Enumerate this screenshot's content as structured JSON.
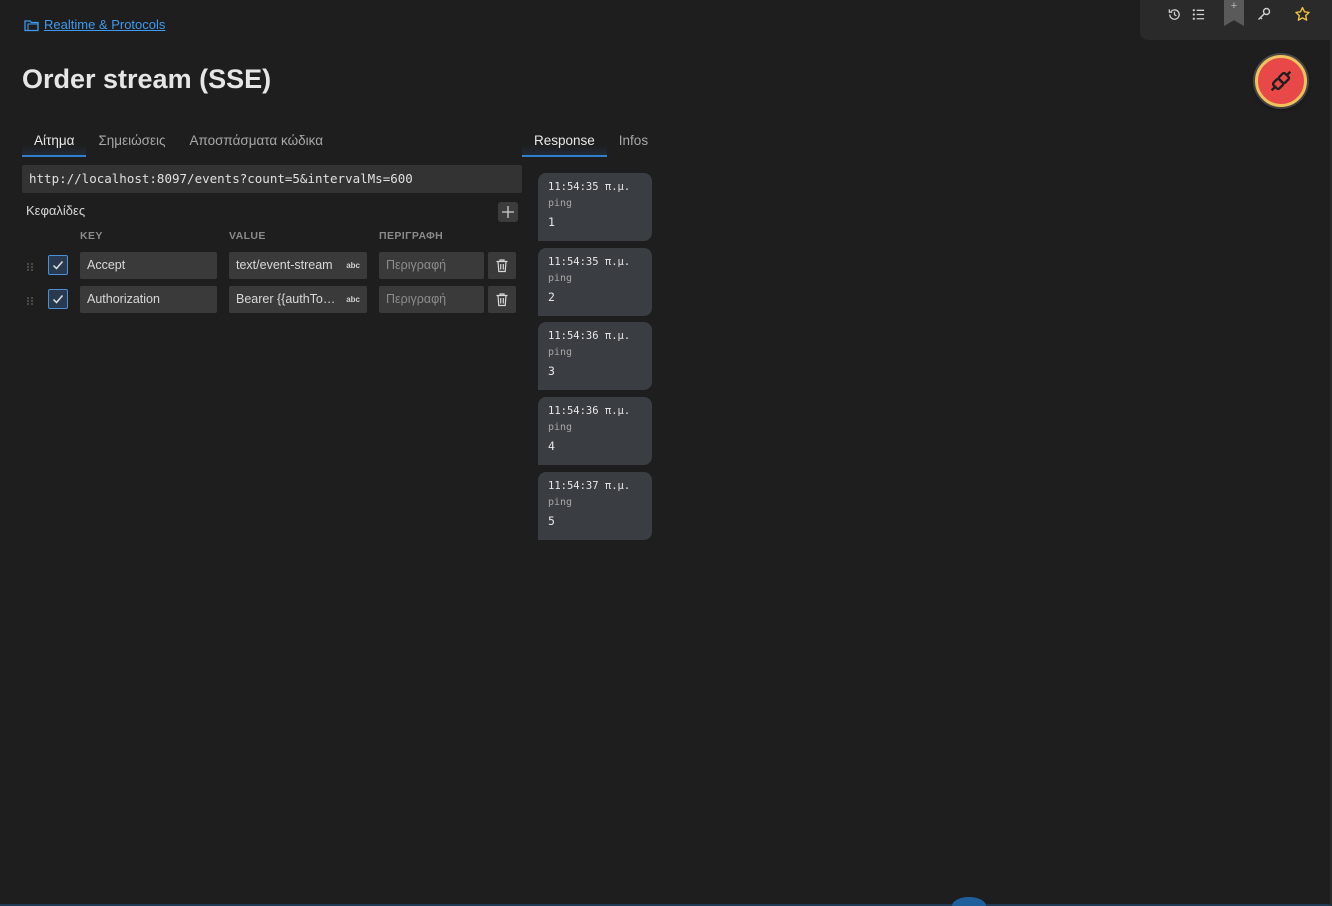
{
  "breadcrumb": {
    "label": "Realtime & Protocols",
    "icon": "folder-icon"
  },
  "title": "Order stream (SSE)",
  "toolbar": {
    "icons": [
      "history-icon",
      "list-icon",
      "bookmark-icon",
      "key-icon",
      "star-icon"
    ],
    "bookmark_glyph": "+"
  },
  "request_tabs": [
    {
      "label": "Αίτημα",
      "active": true
    },
    {
      "label": "Σημειώσεις",
      "active": false
    },
    {
      "label": "Αποσπάσματα κώδικα",
      "active": false
    }
  ],
  "response_tabs": [
    {
      "label": "Response",
      "active": true
    },
    {
      "label": "Infos",
      "active": false
    }
  ],
  "url": "http://localhost:8097/events?count=5&intervalMs=600",
  "headers": {
    "label": "Κεφαλίδες",
    "columns": {
      "key": "KEY",
      "value": "VALUE",
      "description": "ΠΕΡΙΓΡΑΦΗ"
    },
    "rows": [
      {
        "enabled": true,
        "key": "Accept",
        "value": "text/event-stream",
        "value_type": "abc",
        "description_placeholder": "Περιγραφή"
      },
      {
        "enabled": true,
        "key": "Authorization",
        "value": "Bearer {{authToken}}",
        "value_type": "abc",
        "description_placeholder": "Περιγραφή"
      }
    ]
  },
  "events": [
    {
      "time": "11:54:35 π.μ.",
      "type": "ping",
      "data": "1"
    },
    {
      "time": "11:54:35 π.μ.",
      "type": "ping",
      "data": "2"
    },
    {
      "time": "11:54:36 π.μ.",
      "type": "ping",
      "data": "3"
    },
    {
      "time": "11:54:36 π.μ.",
      "type": "ping",
      "data": "4"
    },
    {
      "time": "11:54:37 π.μ.",
      "type": "ping",
      "data": "5"
    }
  ],
  "colors": {
    "accent": "#2f7fd1",
    "link": "#3d9af0",
    "fab": "#e94848",
    "fab_ring": "#f1c15c"
  }
}
